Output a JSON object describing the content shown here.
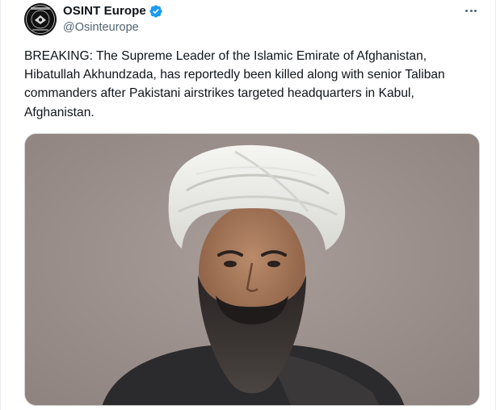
{
  "author": {
    "display_name": "OSINT Europe",
    "handle": "@Osinteurope",
    "verified": true,
    "avatar_text": "OSINT EUROPE"
  },
  "menu": {
    "more_icon": "more-horizontal-icon"
  },
  "tweet": {
    "text": "BREAKING: The Supreme Leader of the Islamic Emirate of Afghanistan, Hibatullah Akhundzada, has reportedly been killed along with senior Taliban commanders after Pakistani airstrikes targeted headquarters in Kabul, Afghanistan."
  },
  "media": {
    "type": "photo",
    "subject": "portrait"
  },
  "colors": {
    "verified_blue": "#1d9bf0",
    "text_primary": "#0f1419",
    "text_secondary": "#536471",
    "photo_background": "#9b8f8a"
  }
}
